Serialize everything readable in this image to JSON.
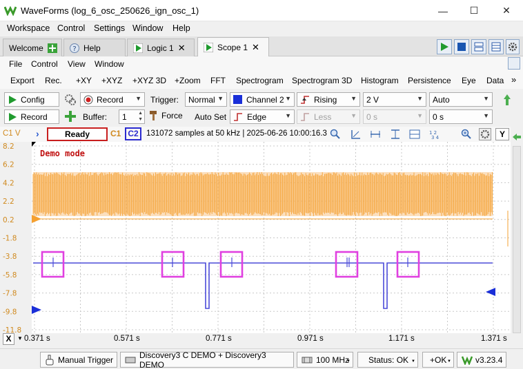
{
  "window": {
    "title": "WaveForms (log_6_osc_250626_ign_osc_1)",
    "minimize": "—",
    "maximize": "☐",
    "close": "✕"
  },
  "menu": [
    "Workspace",
    "Control",
    "Settings",
    "Window",
    "Help"
  ],
  "tabs": [
    {
      "label": "Welcome"
    },
    {
      "label": "Help"
    },
    {
      "label": "Logic 1"
    },
    {
      "label": "Scope 1"
    }
  ],
  "scope_menu": [
    "File",
    "Control",
    "View",
    "Window"
  ],
  "tools": [
    "Export",
    "Rec.",
    "+XY",
    "+XYZ",
    "+XYZ 3D",
    "+Zoom",
    "FFT",
    "Spectrogram",
    "Spectrogram 3D",
    "Histogram",
    "Persistence",
    "Eye",
    "Data"
  ],
  "tools_more": "»",
  "controls": {
    "config": "Config",
    "record_mode": "Record",
    "record_btn": "Record",
    "trigger_label": "Trigger:",
    "trigger_mode": "Normal",
    "trigger_source": "Channel 2",
    "trigger_edge": "Rising",
    "trigger_level": "2 V",
    "trigger_auto": "Auto",
    "buffer_label": "Buffer:",
    "buffer_value": "1",
    "force": "Force",
    "autoset": "Auto Set",
    "edge_type": "Edge",
    "less": "Less",
    "holdoff": "0 s",
    "position": "0 s"
  },
  "status": {
    "channel": "C1 V",
    "state": "Ready",
    "c1": "C1",
    "c2": "C2",
    "info": "131072 samples at 50 kHz | 2025-06-26 10:00:16.3",
    "y_btn": "Y"
  },
  "demo_mode": "Demo mode",
  "y_ticks": [
    "8.2",
    "6.2",
    "4.2",
    "2.2",
    "0.2",
    "-1.8",
    "-3.8",
    "-5.8",
    "-7.8",
    "-9.8",
    "-11.8"
  ],
  "x_ticks": [
    "0.371 s",
    "0.571 s",
    "0.771 s",
    "0.971 s",
    "1.171 s",
    "1.371 s"
  ],
  "x_btn": "X",
  "colors": {
    "ch1": "#f5a030",
    "ch2": "#4040d0",
    "highlight": "#e040e0",
    "ready_border": "#c81e1e"
  },
  "bottom": {
    "manual_trigger": "Manual Trigger",
    "device": "Discovery3 C DEMO + Discovery3 DEMO",
    "freq": "100 MHz",
    "status": "Status: OK",
    "ok": "+OK",
    "version": "v3.23.4"
  }
}
